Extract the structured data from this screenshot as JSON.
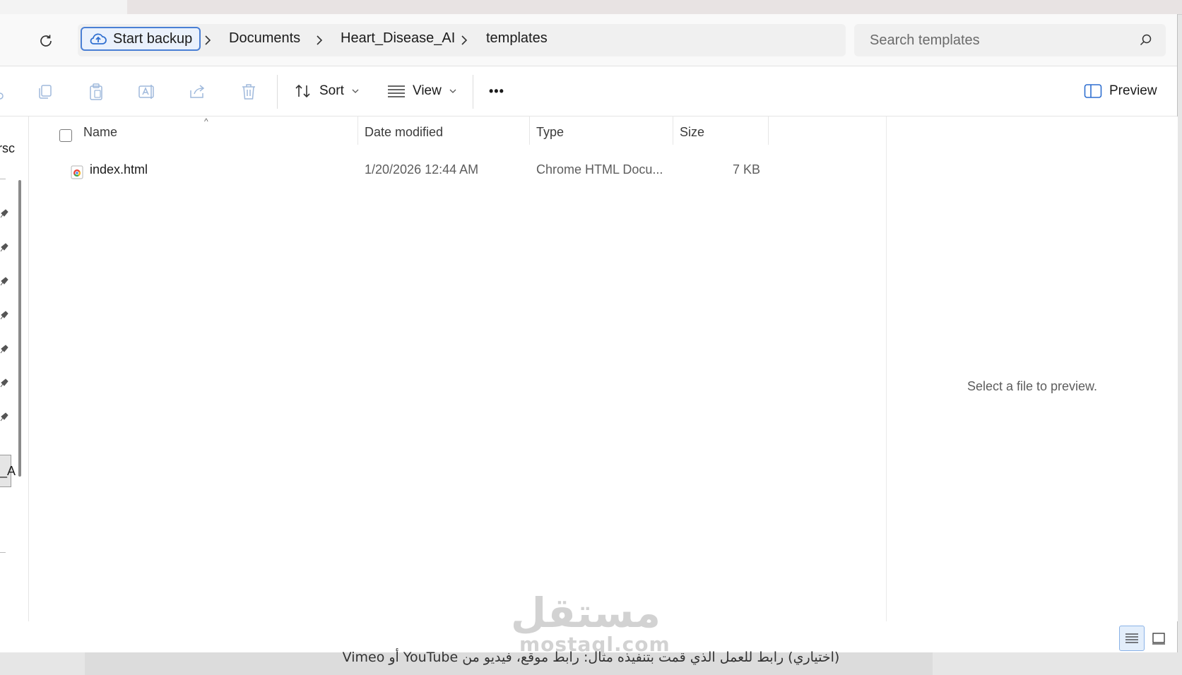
{
  "address": {
    "backup_label": "Start backup",
    "breadcrumbs": [
      "Documents",
      "Heart_Disease_AI",
      "templates"
    ],
    "search_placeholder": "Search templates"
  },
  "toolbar": {
    "sort_label": "Sort",
    "view_label": "View",
    "more_label": "•••",
    "preview_label": "Preview"
  },
  "columns": {
    "name": "Name",
    "date": "Date modified",
    "type": "Type",
    "size": "Size"
  },
  "files": [
    {
      "name": "index.html",
      "date": "1/20/2026 12:44 AM",
      "type": "Chrome HTML Docu...",
      "size": "7 KB",
      "icon": "chrome-html-file-icon"
    }
  ],
  "preview_pane": {
    "message": "Select a file to preview."
  },
  "nav_partial": {
    "top_text": "rsc",
    "bottom_text": "_A"
  },
  "background_page": {
    "caption": "(اختياري) رابط للعمل الذي قمت بتنفيذه مثال: رابط موقع، فيديو من YouTube أو Vimeo"
  },
  "watermark": {
    "arabic": "مستقل",
    "latin": "mostaql.com"
  }
}
